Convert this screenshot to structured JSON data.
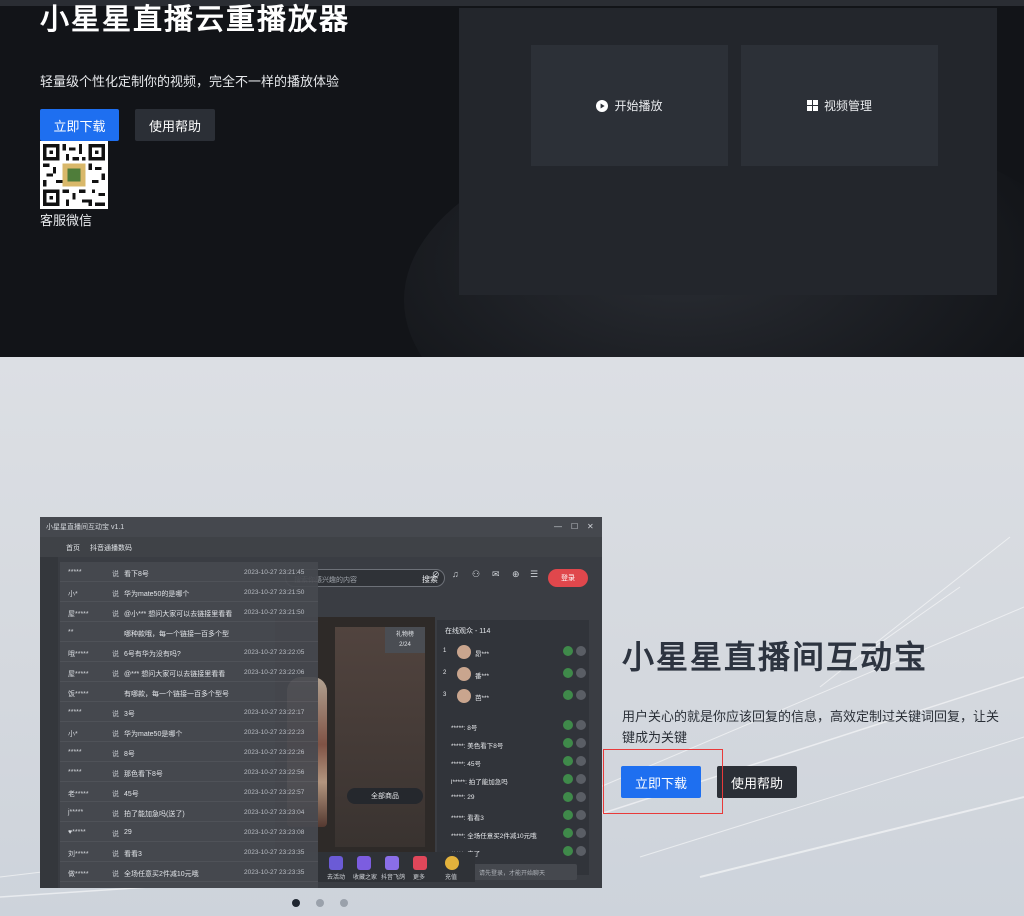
{
  "top_hero": {
    "title": "小星星直播云重播放器",
    "subtitle": "轻量级个性化定制你的视频，完全不一样的播放体验",
    "download_label": "立即下载",
    "help_label": "使用帮助",
    "qr_label": "客服微信",
    "player_cards": [
      {
        "label": "开始播放",
        "icon": "play-circle-icon"
      },
      {
        "label": "视频管理",
        "icon": "grid-icon"
      }
    ]
  },
  "bottom_hero": {
    "title": "小星星直播间互动宝",
    "description": "用户关心的就是你应该回复的信息，高效定制过关键词回复，让关键成为关键",
    "download_label": "立即下载",
    "help_label": "使用帮助",
    "highlight_color": "#e83a3a"
  },
  "carousel": {
    "count": 3,
    "active": 0
  },
  "app_mock": {
    "window_title": "小星星直播间互动宝 v1.1",
    "nav": [
      "首页",
      "抖音通播数码"
    ],
    "search_placeholder": "搜索你感兴趣的内容",
    "search_button": "搜索",
    "login_label": "登录",
    "top_icons": [
      "⊘",
      "♫",
      "⚇",
      "✉",
      "⊕",
      "☰"
    ],
    "viewer_badge": [
      "礼物榜",
      "2/24"
    ],
    "goods_label": "全部商品",
    "online_header": "在线观众 - 114",
    "chat_input": "请先登录，才能开始聊天",
    "comments": [
      {
        "user": "*****",
        "sep": "说",
        "msg": "看下8号",
        "date": "2023-10-27 23:21:45"
      },
      {
        "user": "小*",
        "sep": "说",
        "msg": "华为mate50的是哪个",
        "date": "2023-10-27 23:21:50"
      },
      {
        "user": "屋*****",
        "sep": "说",
        "msg": "@小*** 想问大家可以去链接里看看",
        "date": "2023-10-27 23:21:50"
      },
      {
        "user": "**",
        "sep": "",
        "msg": "哪种款哦，每一个链接一百多个型",
        "date": ""
      },
      {
        "user": "哦*****",
        "sep": "说",
        "msg": "6号有华为没有吗?",
        "date": "2023-10-27 23:22:05"
      },
      {
        "user": "屋*****",
        "sep": "说",
        "msg": "@*** 想问大家可以去链接里看看",
        "date": "2023-10-27 23:22:06"
      },
      {
        "user": "饭*****",
        "sep": "",
        "msg": "有哪款，每一个链接一百多个型号",
        "date": ""
      },
      {
        "user": "*****",
        "sep": "说",
        "msg": "3号",
        "date": "2023-10-27 23:22:17"
      },
      {
        "user": "小*",
        "sep": "说",
        "msg": "华为mate50是哪个",
        "date": "2023-10-27 23:22:23"
      },
      {
        "user": "*****",
        "sep": "说",
        "msg": "8号",
        "date": "2023-10-27 23:22:26"
      },
      {
        "user": "*****",
        "sep": "说",
        "msg": "那色看下8号",
        "date": "2023-10-27 23:22:56"
      },
      {
        "user": "老*****",
        "sep": "说",
        "msg": "45号",
        "date": "2023-10-27 23:22:57"
      },
      {
        "user": "j*****",
        "sep": "说",
        "msg": "拍了能加急吗(送了)",
        "date": "2023-10-27 23:23:04"
      },
      {
        "user": "♥*****",
        "sep": "说",
        "msg": "29",
        "date": "2023-10-27 23:23:08"
      },
      {
        "user": "刘*****",
        "sep": "说",
        "msg": "看看3",
        "date": "2023-10-27 23:23:35"
      },
      {
        "user": "做*****",
        "sep": "说",
        "msg": "全场任意买2件减10元哦",
        "date": "2023-10-27 23:23:35"
      }
    ],
    "online_rows": [
      {
        "tag": "1",
        "name": "昂***"
      },
      {
        "tag": "2",
        "name": "番***"
      },
      {
        "tag": "3",
        "name": "芭***"
      }
    ],
    "chat_rows": [
      "*****: 8号",
      "*****: 美色看下8号",
      "*****: 45号",
      "l*****: 拍了能加急吗",
      "*****: 29",
      "*****: 看看3",
      "*****: 全场任意买2件减10元哦",
      "*****: 来了"
    ],
    "bottom_items": [
      "去活动",
      "收藏之家",
      "抖音飞鸽",
      "更多",
      "充值"
    ]
  }
}
